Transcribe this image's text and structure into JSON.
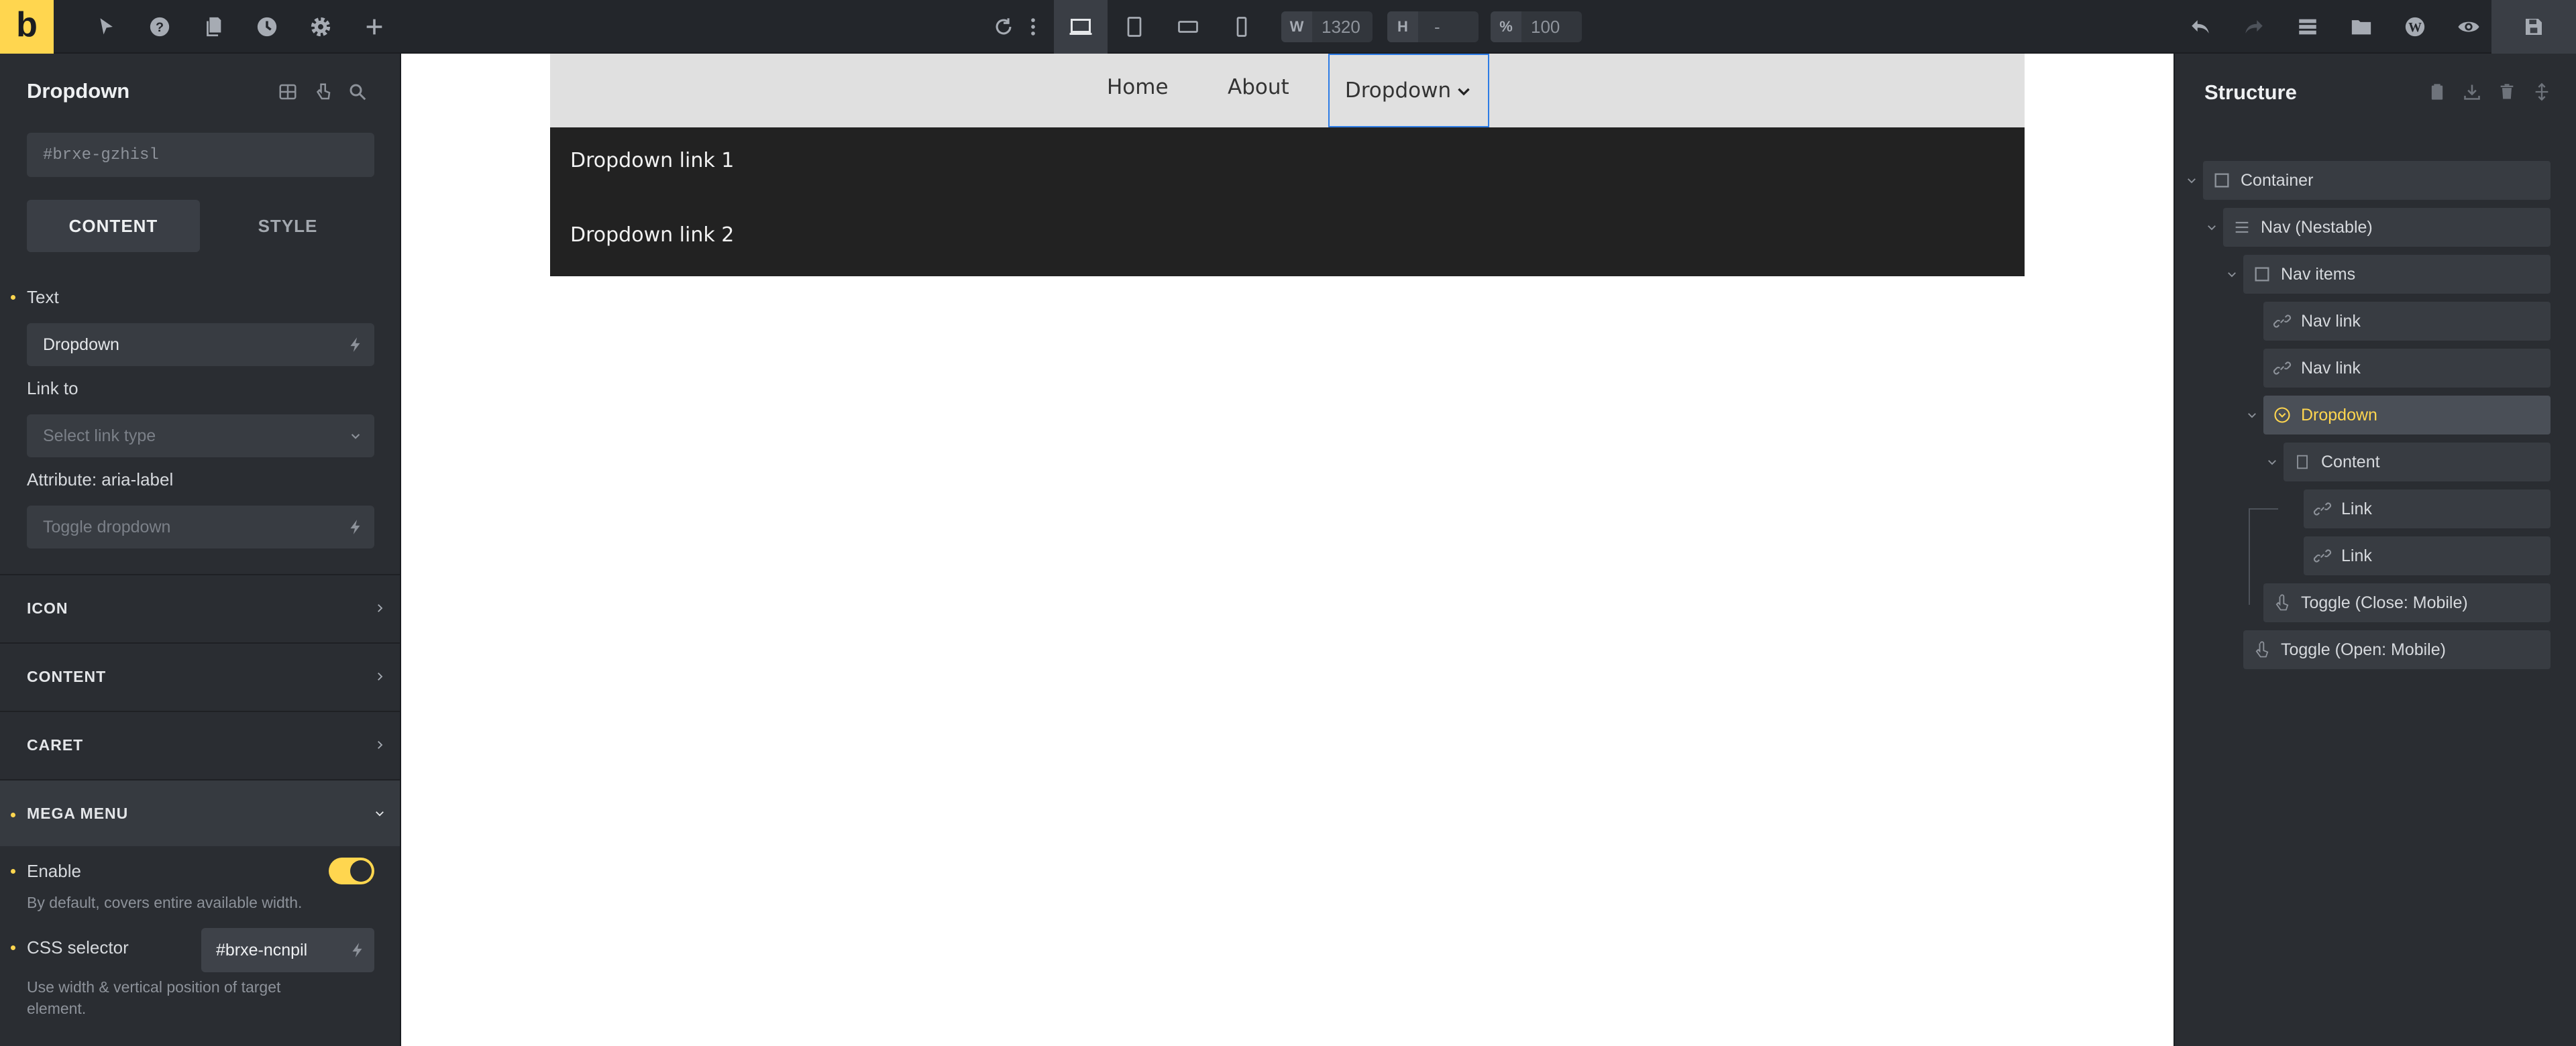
{
  "topbar": {
    "logo_letter": "b",
    "width_label": "W",
    "width_value": "1320",
    "height_label": "H",
    "height_value": "-",
    "scale_label": "%",
    "scale_value": "100"
  },
  "left_panel": {
    "title": "Dropdown",
    "element_id": "#brxe-gzhisl",
    "tabs": {
      "content": "CONTENT",
      "style": "STYLE"
    },
    "text_label": "Text",
    "text_value": "Dropdown",
    "link_label": "Link to",
    "link_placeholder": "Select link type",
    "aria_label": "Attribute: aria-label",
    "aria_placeholder": "Toggle dropdown",
    "sections": [
      "ICON",
      "CONTENT",
      "CARET",
      "MEGA MENU"
    ],
    "enable_label": "Enable",
    "enable_on": true,
    "enable_help": "By default, covers entire available width.",
    "css_selector_label": "CSS selector",
    "css_selector_value": "#brxe-ncnpil",
    "css_help_line1": "Use width & vertical position of target",
    "css_help_line2": "element."
  },
  "canvas": {
    "nav_links": [
      "Home",
      "About"
    ],
    "dropdown_label": "Dropdown",
    "dropdown_items": [
      "Dropdown link 1",
      "Dropdown link 2"
    ]
  },
  "structure": {
    "title": "Structure",
    "items": [
      {
        "label": "Container",
        "icon": "container-icon"
      },
      {
        "label": "Nav (Nestable)",
        "icon": "menu-icon"
      },
      {
        "label": "Nav items",
        "icon": "container-icon"
      },
      {
        "label": "Nav link",
        "icon": "link-icon"
      },
      {
        "label": "Nav link",
        "icon": "link-icon"
      },
      {
        "label": "Dropdown",
        "icon": "dropdown-icon",
        "selected": true
      },
      {
        "label": "Content",
        "icon": "container-icon"
      },
      {
        "label": "Link",
        "icon": "link-icon"
      },
      {
        "label": "Link",
        "icon": "link-icon"
      },
      {
        "label": "Toggle (Close: Mobile)",
        "icon": "hand-icon"
      },
      {
        "label": "Toggle (Open: Mobile)",
        "icon": "hand-icon"
      }
    ]
  },
  "colors": {
    "accent": "#ffd64f",
    "panel_bg": "#2a2d32",
    "selection_outline": "#2c7be5"
  }
}
